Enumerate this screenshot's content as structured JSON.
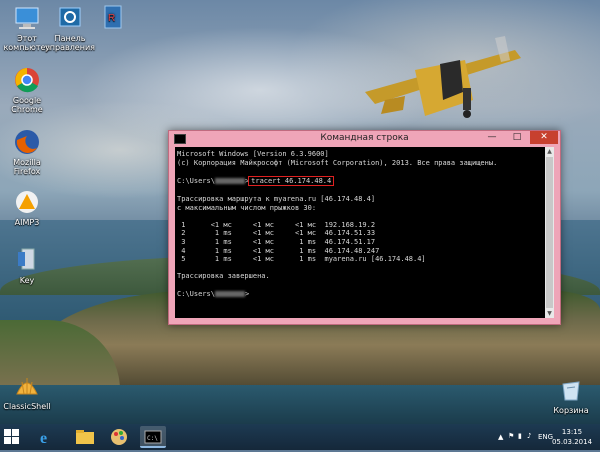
{
  "desktop_icons": [
    {
      "label": "Этот компьютер",
      "icon": "computer-icon"
    },
    {
      "label": "Панель управления",
      "icon": "control-panel-icon"
    },
    {
      "label": "",
      "icon": "user-folder-icon"
    },
    {
      "label": "Google Chrome",
      "icon": "chrome-icon"
    },
    {
      "label": "Mozilla Firefox",
      "icon": "firefox-icon"
    },
    {
      "label": "AIMP3",
      "icon": "aimp-icon"
    },
    {
      "label": "Key",
      "icon": "key-icon"
    },
    {
      "label": "ClassicShell",
      "icon": "classicshell-icon"
    },
    {
      "label": "Корзина",
      "icon": "recycle-bin-icon"
    }
  ],
  "cmd": {
    "title": "Командная строка",
    "minimize": "—",
    "maximize": "□",
    "close": "✕",
    "lines": {
      "l1": "Microsoft Windows [Version 6.3.9600]",
      "l2": "(c) Корпорация Майкрософт (Microsoft Corporation), 2013. Все права защищены.",
      "prompt_prefix": "C:\\Users\\",
      "prompt_suffix": ">",
      "command": "tracert 46.174.48.4",
      "trace_header1": "Трассировка маршрута к myarena.ru [46.174.48.4]",
      "trace_header2": "с максимальным числом прыжков 30:",
      "hops": [
        " 1      <1 мс     <1 мс     <1 мс  192.168.19.2",
        " 2       1 ms     <1 мс     <1 мс  46.174.51.33",
        " 3       1 ms     <1 мс      1 ms  46.174.51.17",
        " 4       1 ms     <1 мс      1 ms  46.174.48.247",
        " 5       1 ms     <1 мс      1 ms  myarena.ru [46.174.48.4]"
      ],
      "trace_done": "Трассировка завершена.",
      "final_prompt_prefix": "C:\\Users\\",
      "final_prompt_suffix": ">"
    }
  },
  "taskbar": {
    "language": "ENG",
    "time": "13:15",
    "date": "05.03.2014"
  },
  "colors": {
    "cmd_title_bg": "#efa5b8",
    "close_button": "#c7402f",
    "highlight": "#e02020",
    "taskbar": "#1d3a52"
  }
}
